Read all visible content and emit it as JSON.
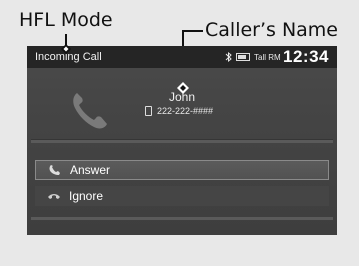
{
  "callouts": {
    "hfl_mode": "HFL Mode",
    "callers_name": "Caller’s Name"
  },
  "status_bar": {
    "title": "Incoming Call",
    "icons": [
      "bluetooth-icon",
      "battery-icon",
      "signal-icon"
    ],
    "signal_label": "Tall RM",
    "time": "12:34"
  },
  "caller": {
    "name": "John",
    "number": "222-222-####"
  },
  "options": [
    {
      "label": "Answer",
      "icon": "answer-phone-icon"
    },
    {
      "label": "Ignore",
      "icon": "ignore-phone-icon"
    }
  ]
}
